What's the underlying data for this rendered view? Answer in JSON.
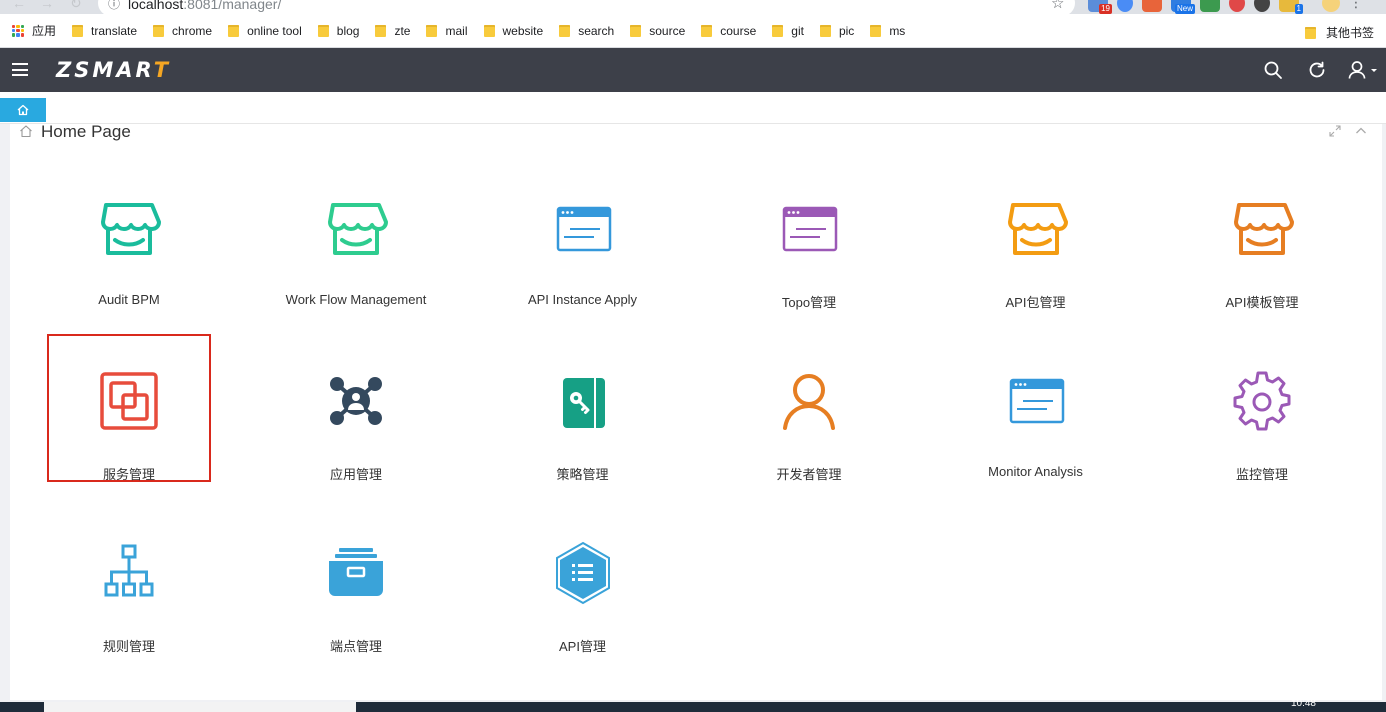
{
  "browser": {
    "url_host": "localhost",
    "url_rest": ":8081/manager/",
    "bookmarks": [
      {
        "label": "应用",
        "kind": "apps"
      },
      {
        "label": "translate",
        "kind": "folder"
      },
      {
        "label": "chrome",
        "kind": "folder"
      },
      {
        "label": "online tool",
        "kind": "folder"
      },
      {
        "label": "blog",
        "kind": "folder"
      },
      {
        "label": "zte",
        "kind": "folder"
      },
      {
        "label": "mail",
        "kind": "folder"
      },
      {
        "label": "website",
        "kind": "folder"
      },
      {
        "label": "search",
        "kind": "folder"
      },
      {
        "label": "source",
        "kind": "folder"
      },
      {
        "label": "course",
        "kind": "folder"
      },
      {
        "label": "git",
        "kind": "folder"
      },
      {
        "label": "pic",
        "kind": "folder"
      },
      {
        "label": "ms",
        "kind": "folder"
      }
    ],
    "other_bookmarks": "其他书签",
    "ext_badges": {
      "first": "19",
      "new": "New",
      "last": "1"
    }
  },
  "header": {
    "logo_main": "ZSMAR",
    "logo_accent": "T",
    "icons": [
      "search-icon",
      "refresh-icon",
      "user-icon"
    ]
  },
  "panel": {
    "title": "Home Page"
  },
  "tiles": [
    {
      "label": "Audit BPM",
      "icon": "store-icon",
      "color": "#1abc9c",
      "selected": false
    },
    {
      "label": "Work Flow Management",
      "icon": "store-icon",
      "color": "#2ecc8f",
      "selected": false
    },
    {
      "label": "API Instance Apply",
      "icon": "window-icon",
      "color": "#3498db",
      "selected": false
    },
    {
      "label": "Topo管理",
      "icon": "window-icon",
      "color": "#9b59b6",
      "selected": false
    },
    {
      "label": "API包管理",
      "icon": "store-icon",
      "color": "#f39c12",
      "selected": false
    },
    {
      "label": "API模板管理",
      "icon": "store-icon",
      "color": "#e67e22",
      "selected": false
    },
    {
      "label": "服务管理",
      "icon": "overlap-squares-icon",
      "color": "#e74c3c",
      "selected": true
    },
    {
      "label": "应用管理",
      "icon": "network-icon",
      "color": "#34495e",
      "selected": false
    },
    {
      "label": "策略管理",
      "icon": "key-card-icon",
      "color": "#16a085",
      "selected": false
    },
    {
      "label": "开发者管理",
      "icon": "person-icon",
      "color": "#e67e22",
      "selected": false
    },
    {
      "label": "Monitor Analysis",
      "icon": "window-icon",
      "color": "#3498db",
      "selected": false
    },
    {
      "label": "监控管理",
      "icon": "gear-icon",
      "color": "#9b59b6",
      "selected": false
    },
    {
      "label": "规则管理",
      "icon": "hierarchy-icon",
      "color": "#3aa3d9",
      "selected": false
    },
    {
      "label": "端点管理",
      "icon": "tray-icon",
      "color": "#3aa3d9",
      "selected": false
    },
    {
      "label": "API管理",
      "icon": "hexagon-list-icon",
      "color": "#3aa3d9",
      "selected": false
    }
  ],
  "taskbar": {
    "clock": "10:48"
  }
}
